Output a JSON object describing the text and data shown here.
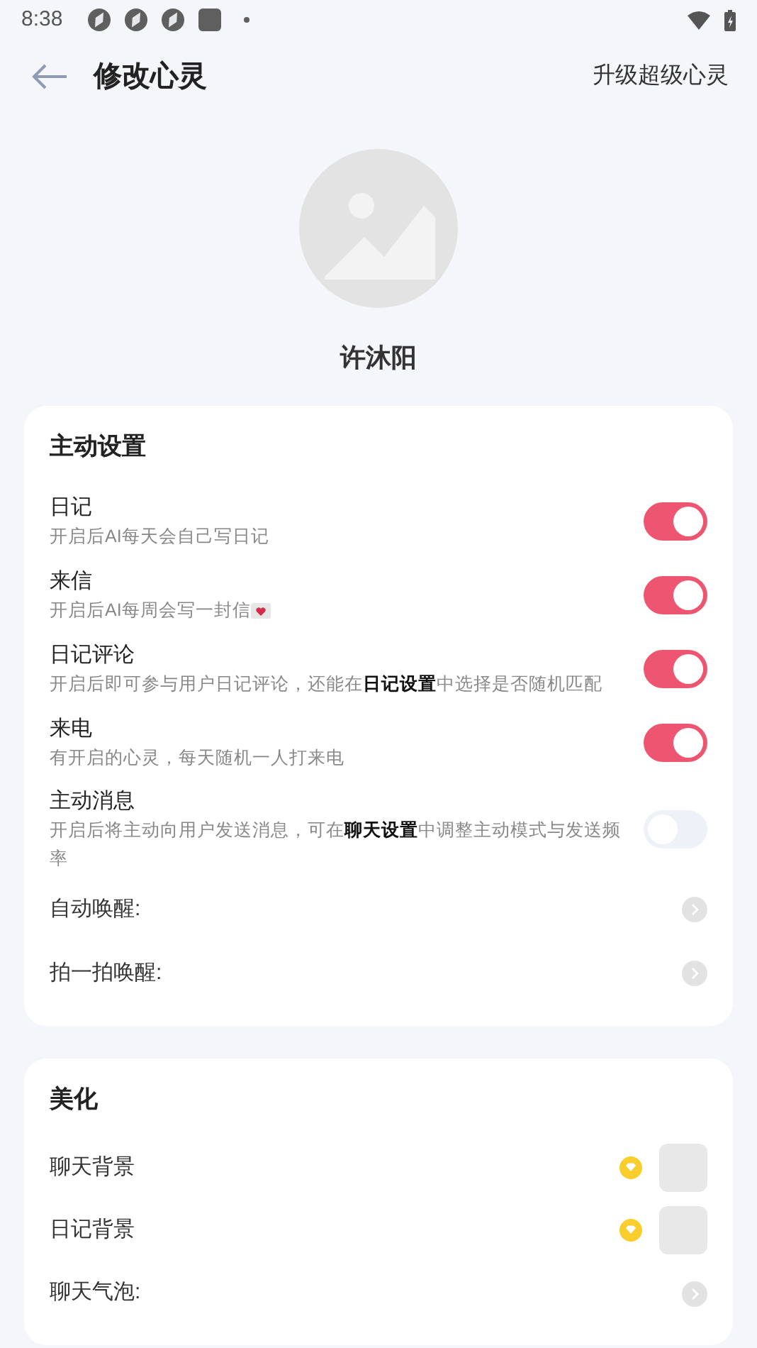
{
  "status_bar": {
    "time": "8:38"
  },
  "header": {
    "title": "修改心灵",
    "action": "升级超级心灵"
  },
  "profile": {
    "name": "许沐阳"
  },
  "sections": [
    {
      "title": "主动设置",
      "items": [
        {
          "kind": "toggle",
          "label": "日记",
          "description": "开启后AI每天会自己写日记",
          "on": true
        },
        {
          "kind": "toggle",
          "label": "来信",
          "description": "开启后AI每周会写一封信",
          "letter_icon": true,
          "on": true
        },
        {
          "kind": "toggle",
          "label": "日记评论",
          "description": "开启后即可参与用户日记评论，还能在**日记设置**中选择是否随机匹配",
          "on": true
        },
        {
          "kind": "toggle",
          "label": "来电",
          "description": "有开启的心灵，每天随机一人打来电",
          "on": true
        },
        {
          "kind": "toggle",
          "label": "主动消息",
          "description": "开启后将主动向用户发送消息，可在**聊天设置**中调整主动模式与发送频率",
          "on": false
        },
        {
          "kind": "link",
          "label": "自动唤醒:"
        },
        {
          "kind": "link",
          "label": "拍一拍唤醒:"
        }
      ]
    },
    {
      "title": "美化",
      "items": [
        {
          "kind": "image",
          "label": "聊天背景"
        },
        {
          "kind": "image",
          "label": "日记背景"
        },
        {
          "kind": "link",
          "label": "聊天气泡:"
        }
      ]
    }
  ]
}
